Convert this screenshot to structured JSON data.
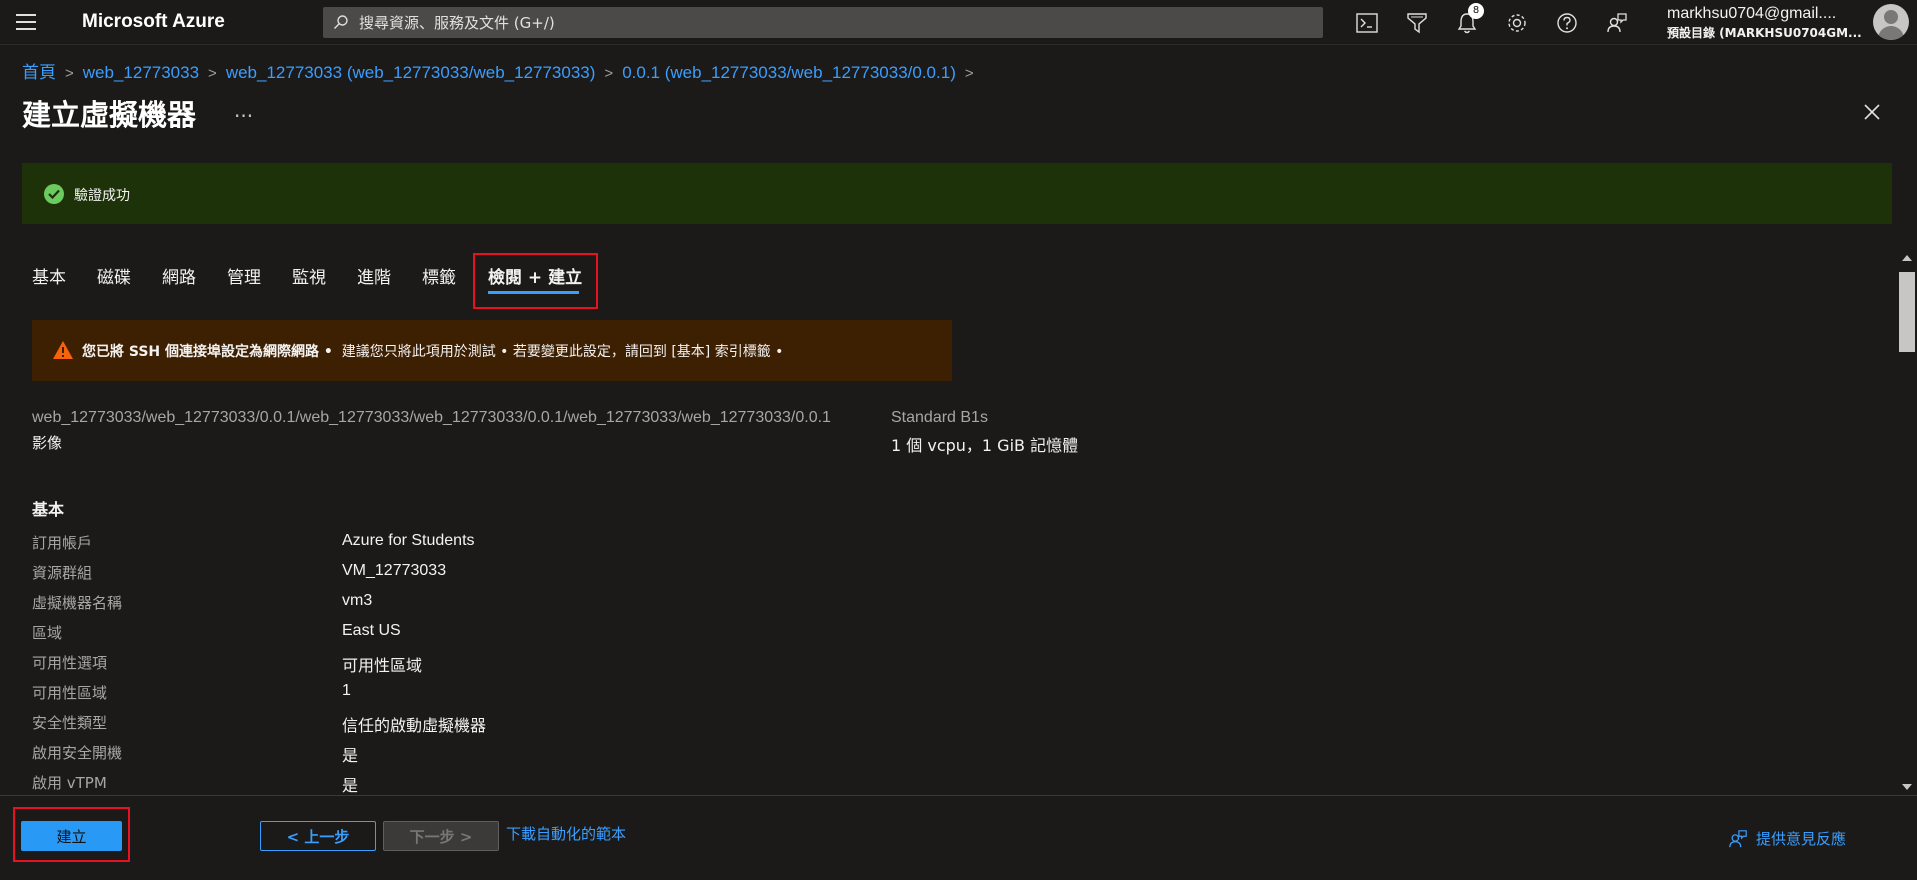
{
  "topbar": {
    "brand": "Microsoft Azure",
    "search_placeholder": "搜尋資源、服務及文件 (G+/)",
    "notification_count": "8",
    "account_email": "markhsu0704@gmail....",
    "account_directory": "預設目錄 (MARKHSU0704GM..."
  },
  "breadcrumb": [
    "首頁",
    "web_12773033",
    "web_12773033 (web_12773033/web_12773033)",
    "0.0.1 (web_12773033/web_12773033/0.0.1)"
  ],
  "page": {
    "title": "建立虛擬機器",
    "ellipsis": "...",
    "validation_message": "驗證成功"
  },
  "tabs": [
    "基本",
    "磁碟",
    "網路",
    "管理",
    "監視",
    "進階",
    "標籤",
    "檢閱 + 建立"
  ],
  "active_tab": "檢閱 + 建立",
  "warning": {
    "bold": "您已將 SSH 個連接埠設定為網際網路 •",
    "text": "建議您只將此項用於測試 •  若要變更此設定，請回到 [基本] 索引標籤 •"
  },
  "summary": {
    "image_path": "web_12773033/web_12773033/0.0.1/web_12773033/web_12773033/0.0.1/web_12773033/web_12773033/0.0.1",
    "image_label": "影像",
    "size_name": "Standard B1s",
    "size_spec": "1 個 vcpu，1 GiB 記憶體"
  },
  "basics": {
    "title": "基本",
    "rows": [
      {
        "key": "訂用帳戶",
        "value": "Azure for Students"
      },
      {
        "key": "資源群組",
        "value": "VM_12773033"
      },
      {
        "key": "虛擬機器名稱",
        "value": "vm3"
      },
      {
        "key": "區域",
        "value": "East US"
      },
      {
        "key": "可用性選項",
        "value": "可用性區域"
      },
      {
        "key": "可用性區域",
        "value": "1"
      },
      {
        "key": "安全性類型",
        "value": "信任的啟動虛擬機器"
      },
      {
        "key": "啟用安全開機",
        "value": "是"
      },
      {
        "key": "啟用 vTPM",
        "value": "是"
      }
    ]
  },
  "footer": {
    "create": "建立",
    "previous": "< 上一步",
    "next": "下一步 >",
    "download_template": "下載自動化的範本",
    "feedback": "提供意見反應"
  },
  "colors": {
    "accent": "#3a9eff",
    "success_bg": "#1e3209",
    "warning_bg": "#3d1f02",
    "highlight": "#e81123"
  }
}
